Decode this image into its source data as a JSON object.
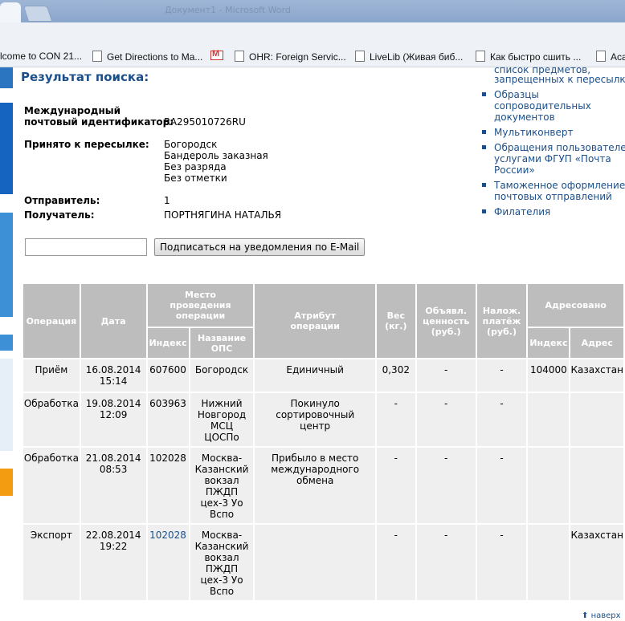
{
  "browser": {
    "window_title": "Документ1 - Microsoft Word",
    "bookmarks": [
      {
        "label": "lcome to CON 21...",
        "icon": "none"
      },
      {
        "label": "Get Directions to Ma...",
        "icon": "page-icon"
      },
      {
        "label": "",
        "icon": "gmail-icon"
      },
      {
        "label": "OHR: Foreign Servic...",
        "icon": "page-icon"
      },
      {
        "label": "LiveLib (Живая биб...",
        "icon": "page-icon"
      },
      {
        "label": "Как быстро сшить ...",
        "icon": "page-icon"
      },
      {
        "label": "Aca",
        "icon": "page-icon"
      }
    ]
  },
  "page": {
    "title": "Результат поиска:",
    "id_label_line1": "Международный",
    "id_label_line2": "почтовый идентификатор:",
    "id_value": "RA295010726RU",
    "accepted_label": "Принято к пересылке:",
    "accepted_values": [
      "Богородск",
      "Бандероль заказная",
      "Без разряда",
      "Без отметки"
    ],
    "sender_label": "Отправитель:",
    "sender_value": "1",
    "recipient_label": "Получатель:",
    "recipient_value": "ПОРТНЯГИНА НАТАЛЬЯ",
    "email_placeholder": "",
    "subscribe_button": "Подписаться на уведомления по E-Mail",
    "back_to_top": "наверх"
  },
  "right_links": [
    {
      "lines": [
        "список предметов,",
        "запрещенных к пересылке"
      ]
    },
    {
      "lines": [
        "Образцы",
        "сопроводительных",
        "документов"
      ]
    },
    {
      "lines": [
        "Мультиконверт"
      ]
    },
    {
      "lines": [
        "Обращения пользователей",
        "услугами ФГУП «Почта",
        "России»"
      ]
    },
    {
      "lines": [
        "Таможенное оформление",
        "почтовых отправлений"
      ]
    },
    {
      "lines": [
        "Филателия"
      ]
    }
  ],
  "table": {
    "headers": {
      "operation": "Операция",
      "date": "Дата",
      "place": "Место проведения операции",
      "place_index": "Индекс",
      "place_name": "Название ОПС",
      "attribute": "Атрибут операции",
      "weight": "Вес (кг.)",
      "declared_value": "Объявл. ценность (руб.)",
      "cod": "Налож. платёж (руб.)",
      "addressed": "Адресовано",
      "addr_index": "Индекс",
      "addr_address": "Адрес"
    },
    "rows": [
      {
        "operation": "Приём",
        "date": "16.08.2014 15:14",
        "index": "607600",
        "place": "Богородск",
        "attribute": "Единичный",
        "weight": "0,302",
        "value": "-",
        "cod": "-",
        "addr_index": "104000",
        "addr": "Казахстан"
      },
      {
        "operation": "Обработка",
        "date": "19.08.2014 12:09",
        "index": "603963",
        "place": "Нижний Новгород МСЦ ЦОСПо",
        "attribute": "Покинуло сортировочный центр",
        "weight": "-",
        "value": "-",
        "cod": "-",
        "addr_index": "",
        "addr": ""
      },
      {
        "operation": "Обработка",
        "date": "21.08.2014 08:53",
        "index": "102028",
        "place": "Москва-Казанский вокзал ПЖДП цех-3 Уо Вспо",
        "attribute": "Прибыло в место международного обмена",
        "weight": "-",
        "value": "-",
        "cod": "-",
        "addr_index": "",
        "addr": ""
      },
      {
        "operation": "Экспорт",
        "date": "22.08.2014 19:22",
        "index": "102028",
        "place": "Москва-Казанский вокзал ПЖДП цех-3 Уо Вспо",
        "attribute": "",
        "weight": "-",
        "value": "-",
        "cod": "-",
        "addr_index": "",
        "addr": "Казахстан"
      }
    ]
  }
}
